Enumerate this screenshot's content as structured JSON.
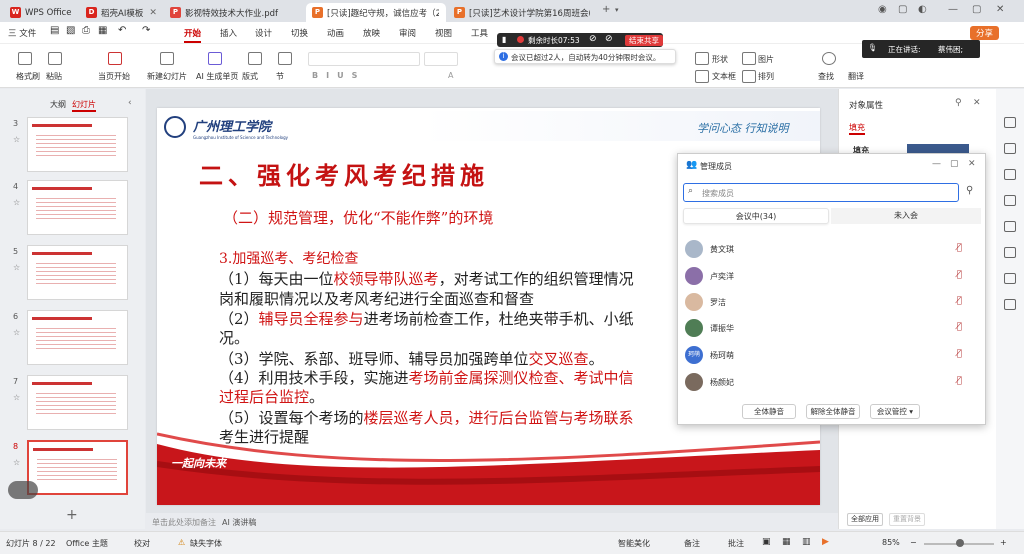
{
  "tabs": [
    {
      "label": "WPS Office",
      "icon": "W",
      "color": "#d9251d"
    },
    {
      "label": "稻壳AI模板",
      "icon": "D",
      "color": "#d9251d"
    },
    {
      "label": "影视特效技术大作业.pdf",
      "icon": "P",
      "color": "#e0443b"
    },
    {
      "label": "[只读]趣纪守规，诚信应考（202…",
      "icon": "P",
      "color": "#e8702a"
    },
    {
      "label": "[只读]艺术设计学院第16周班会(1)…",
      "icon": "P",
      "color": "#e8702a"
    }
  ],
  "menu": {
    "file": "三 文件",
    "items": [
      "开始",
      "插入",
      "设计",
      "切换",
      "动画",
      "放映",
      "审阅",
      "视图",
      "工具"
    ],
    "share": "分享"
  },
  "ribbon": {
    "format_painter": "格式刷",
    "paste": "粘贴",
    "from_current": "当页开始",
    "new_slide": "新建幻灯片",
    "ai_slide": "AI 生成单页",
    "layout": "版式",
    "section": "节",
    "shape": "形状",
    "image": "图片",
    "textbox": "文本框",
    "arrange": "排列",
    "find": "查找",
    "translate": "翻译"
  },
  "meeting": {
    "timer": "剩余时长07:53",
    "end_share": "结束共享",
    "notice": "会议已超过2人，自动转为40分钟限时会议。",
    "speaking_label": "正在讲话:",
    "speaker": "蔡伟困;"
  },
  "left_panel": {
    "tab_outline": "大纲",
    "tab_slides": "幻灯片",
    "slide_numbers": [
      "3",
      "4",
      "5",
      "6",
      "7",
      "8"
    ]
  },
  "slide": {
    "school": "广州理工学院",
    "school_en": "Guangzhou Institute of Science and Technology",
    "motto": "学问心态  行知说明",
    "heading": "二、强化考风考纪措施",
    "subheading": "（二）规范管理，优化“不能作弊”的环境",
    "section": "3.加强巡考、考纪检查",
    "l1a": "（1）每天由一位",
    "l1b": "校领导带队巡考",
    "l1c": "，对考试工作的组织管理情况",
    "l2": "岗和履职情况以及考风考纪进行全面巡查和督查",
    "l3a": "（2）",
    "l3b": "辅导员全程参与",
    "l3c": "进考场前检查工作，杜绝夹带手机、小纸",
    "l4": "况。",
    "l5a": "（3）学院、系部、班导师、辅导员加强跨单位",
    "l5b": "交叉巡查",
    "l5c": "。",
    "l6a": "（4）利用技术手段，实施进",
    "l6b": "考场前金属探测仪检查、考试中信",
    "l7": "过程后台监控",
    "l7b": "。",
    "l8a": "（5）设置每个考场的",
    "l8b": "楼层巡考人员，进行后台监管与考场联系",
    "l9": "考生进行提醒",
    "slogan": "一起向未来"
  },
  "notes_placeholder": "单击此处添加备注",
  "ai_notes": "AI 演讲稿",
  "members": {
    "title": "管理成员",
    "search_placeholder": "搜索成员",
    "tab_in": "会议中(34)",
    "tab_out": "未入会",
    "list": [
      {
        "name": "黄文琪",
        "color": "#a9b7c9"
      },
      {
        "name": "卢奕洋",
        "color": "#8b6fa8"
      },
      {
        "name": "罗洁",
        "color": "#d9b9a0"
      },
      {
        "name": "谭振华",
        "color": "#4f7d55"
      },
      {
        "name": "杨珂萌",
        "color": "#3d6fd1",
        "initials": "珂萌"
      },
      {
        "name": "杨颜妃",
        "color": "#7a6a5e"
      }
    ],
    "mute_all": "全体静音",
    "unmute_all": "解除全体静音",
    "control": "会议管控"
  },
  "right_panel": {
    "title": "对象属性",
    "fill": "填充",
    "fill_sub": "填充",
    "apply_all": "全部应用",
    "reset_bg": "重置背景"
  },
  "status": {
    "slide_count": "幻灯片 8 / 22",
    "theme": "Office 主题",
    "proof": "校对",
    "missing_font": "缺失字体",
    "beautify": "智能美化",
    "notes": "备注",
    "comments": "批注",
    "zoom": "85%"
  }
}
